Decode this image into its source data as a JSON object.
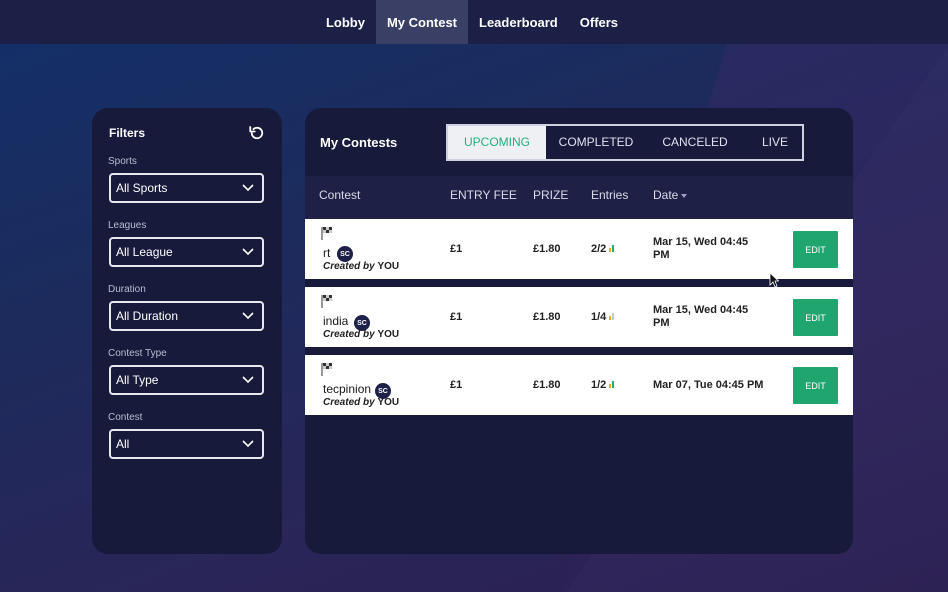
{
  "nav": {
    "items": [
      {
        "label": "Lobby",
        "active": false
      },
      {
        "label": "My Contest",
        "active": true
      },
      {
        "label": "Leaderboard",
        "active": false
      },
      {
        "label": "Offers",
        "active": false
      }
    ]
  },
  "filters": {
    "title": "Filters",
    "groups": [
      {
        "label": "Sports",
        "value": "All Sports"
      },
      {
        "label": "Leagues",
        "value": "All League"
      },
      {
        "label": "Duration",
        "value": "All Duration"
      },
      {
        "label": "Contest Type",
        "value": "All Type"
      },
      {
        "label": "Contest",
        "value": "All"
      }
    ]
  },
  "main": {
    "title": "My Contests",
    "tabs": [
      {
        "label": "UPCOMING",
        "active": true
      },
      {
        "label": "COMPLETED",
        "active": false
      },
      {
        "label": "CANCELED",
        "active": false
      },
      {
        "label": "LIVE",
        "active": false
      }
    ],
    "columns": [
      "Contest",
      "ENTRY FEE",
      "PRIZE",
      "Entries",
      "Date"
    ],
    "rows": [
      {
        "name": "rt",
        "badge": "SC",
        "created_prefix": "Created by",
        "created_by": "YOU",
        "entry_fee": "£1",
        "prize": "£1.80",
        "entries": "2/2",
        "date": "Mar 15, Wed 04:45 PM",
        "action": "EDIT"
      },
      {
        "name": "india",
        "badge": "SC",
        "created_prefix": "Created by",
        "created_by": "YOU",
        "entry_fee": "£1",
        "prize": "£1.80",
        "entries": "1/4",
        "date": "Mar 15, Wed 04:45 PM",
        "action": "EDIT"
      },
      {
        "name": "tecpinion",
        "badge": "SC",
        "created_prefix": "Created by",
        "created_by": "YOU",
        "entry_fee": "£1",
        "prize": "£1.80",
        "entries": "1/2",
        "date": "Mar 07, Tue 04:45 PM",
        "action": "EDIT"
      }
    ]
  },
  "colors": {
    "accent": "#21a56f",
    "tab_active_text": "#22b07d",
    "panel": "#171a3a"
  }
}
